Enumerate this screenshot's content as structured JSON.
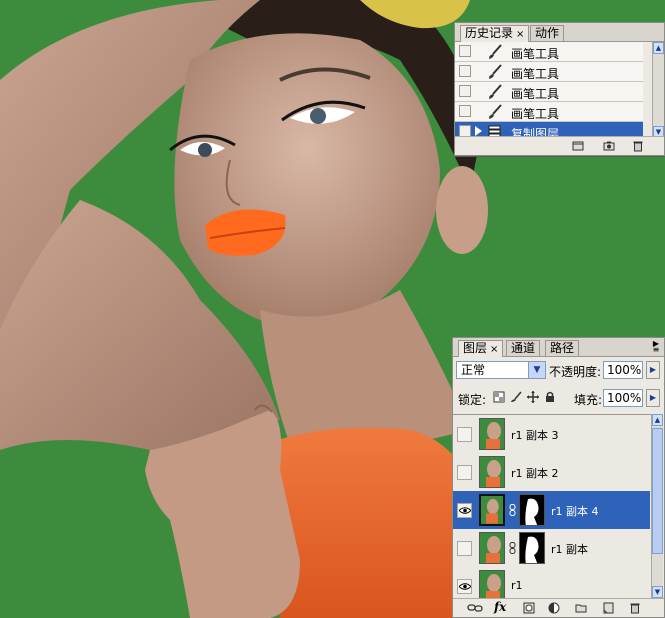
{
  "history_panel": {
    "tabs": [
      {
        "label": "历史记录",
        "close": "×"
      },
      {
        "label": "动作"
      }
    ],
    "items": [
      {
        "label": "画笔工具",
        "icon": "brush-icon",
        "selected": false
      },
      {
        "label": "画笔工具",
        "icon": "brush-icon",
        "selected": false
      },
      {
        "label": "画笔工具",
        "icon": "brush-icon",
        "selected": false
      },
      {
        "label": "画笔工具",
        "icon": "brush-icon",
        "selected": false
      },
      {
        "label": "复制图层",
        "icon": "layer-duplicate-icon",
        "selected": true
      }
    ],
    "footer_icons": [
      "new-document-from-state-icon",
      "snapshot-camera-icon",
      "trash-icon"
    ]
  },
  "layers_panel": {
    "tabs": [
      {
        "label": "图层",
        "close": "×"
      },
      {
        "label": "通道"
      },
      {
        "label": "路径"
      }
    ],
    "blend_mode": "正常",
    "opacity_label": "不透明度:",
    "opacity_value": "100%",
    "lock_label": "锁定:",
    "fill_label": "填充:",
    "fill_value": "100%",
    "lock_icons": [
      "lock-transparent-icon",
      "lock-brush-icon",
      "lock-move-icon",
      "lock-all-icon"
    ],
    "layers": [
      {
        "name": "r1 副本 3",
        "visible": false,
        "has_mask": false,
        "selected": false
      },
      {
        "name": "r1 副本 2",
        "visible": false,
        "has_mask": false,
        "selected": false
      },
      {
        "name": "r1 副本 4",
        "visible": true,
        "has_mask": true,
        "selected": true
      },
      {
        "name": "r1 副本",
        "visible": false,
        "has_mask": true,
        "selected": false
      },
      {
        "name": "r1",
        "visible": true,
        "has_mask": false,
        "selected": false
      }
    ],
    "footer_icons": [
      "link-icon",
      "fx-icon",
      "add-mask-icon",
      "adjustment-layer-icon",
      "new-group-icon",
      "new-layer-icon",
      "trash-icon"
    ],
    "fx_label": "fx"
  },
  "colors": {
    "background_green": "#3d8c3e",
    "selection_blue": "#2f63b9",
    "lip_orange": "#ff6a1f",
    "panel_gray": "#ece9e3"
  }
}
